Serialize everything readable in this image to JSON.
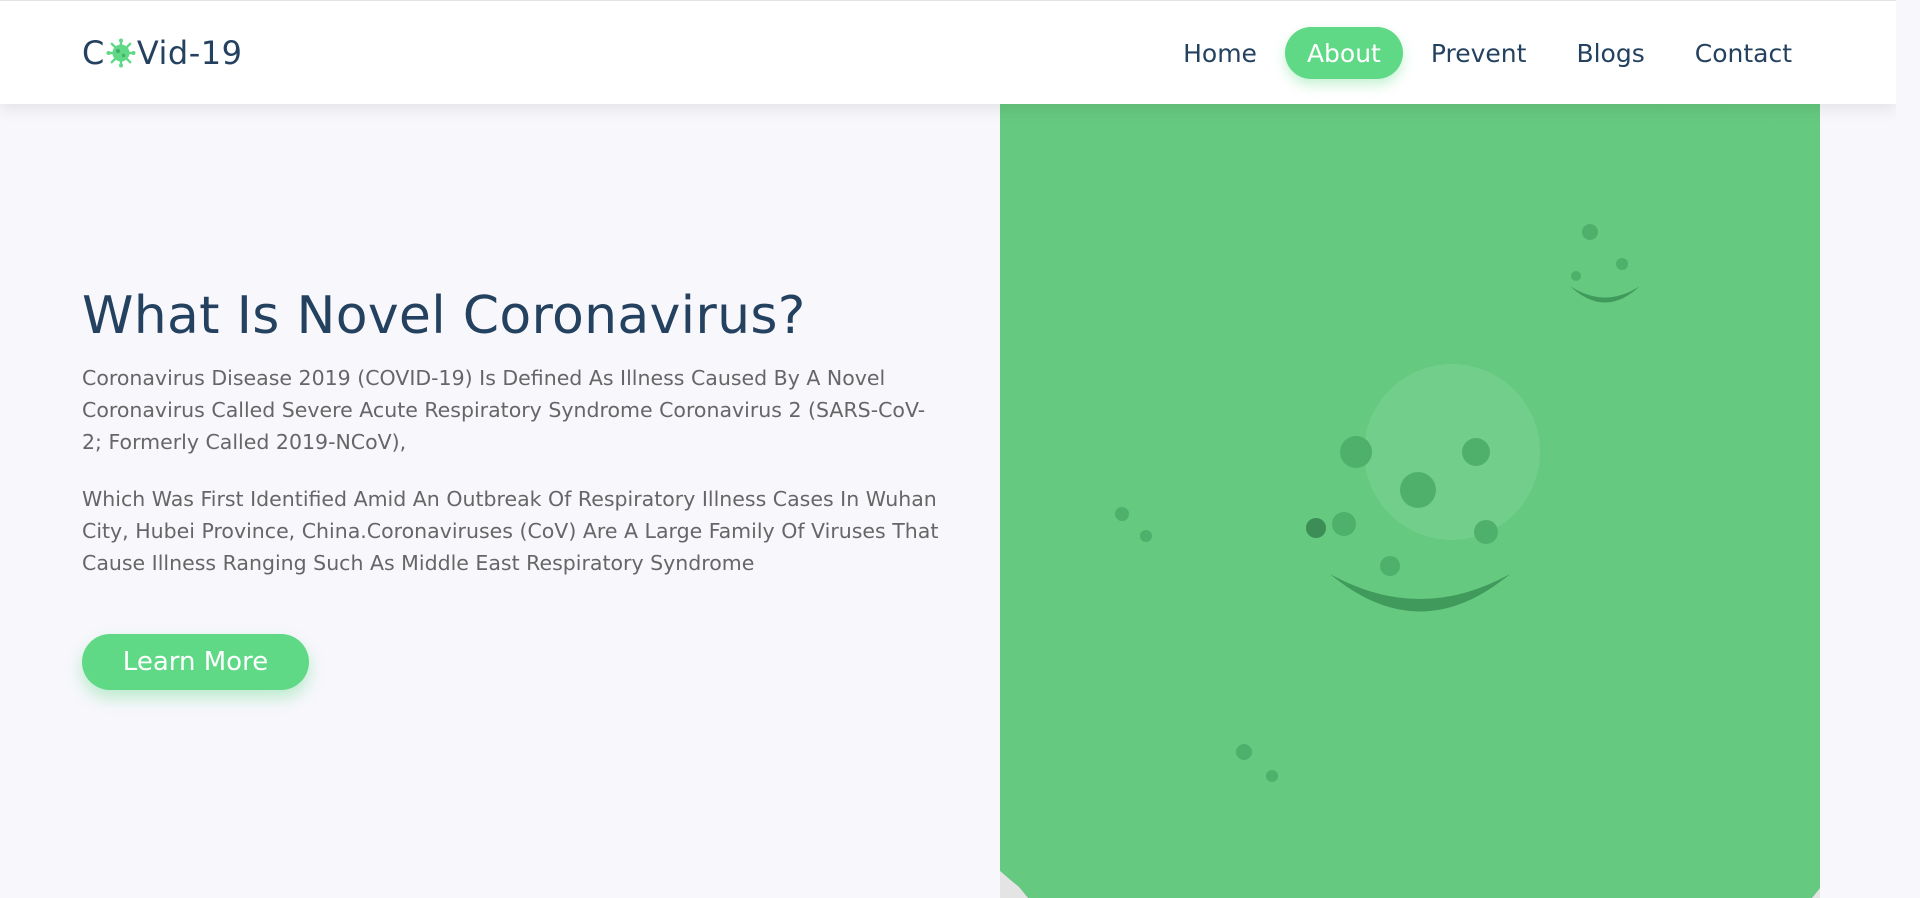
{
  "brand": {
    "prefix": "C",
    "suffix": "Vid-19",
    "icon": "virus-icon"
  },
  "nav": {
    "items": [
      {
        "label": "Home"
      },
      {
        "label": "About",
        "active": true
      },
      {
        "label": "Prevent"
      },
      {
        "label": "Blogs"
      },
      {
        "label": "Contact"
      }
    ]
  },
  "hero": {
    "title": "What Is Novel Coronavirus?",
    "paragraph_1": "Coronavirus Disease 2019 (COVID-19) Is Defined As Illness Caused By A Novel Coronavirus Called Severe Acute Respiratory Syndrome Coronavirus 2 (SARS-CoV-2; Formerly Called 2019-NCoV),",
    "paragraph_2": "Which Was First Identified Amid An Outbreak Of Respiratory Illness Cases In Wuhan City, Hubei Province, China.Coronaviruses (CoV) Are A Large Family Of Viruses That Cause Illness Ranging Such As Middle East Respiratory Syndrome",
    "button_label": "Learn More"
  },
  "colors": {
    "accent": "#5fd986",
    "heading": "#24425f",
    "body_text": "#666666",
    "background": "#f8f7fc",
    "virus_green": "#66c980",
    "virus_grey": "#e6e6e6"
  }
}
